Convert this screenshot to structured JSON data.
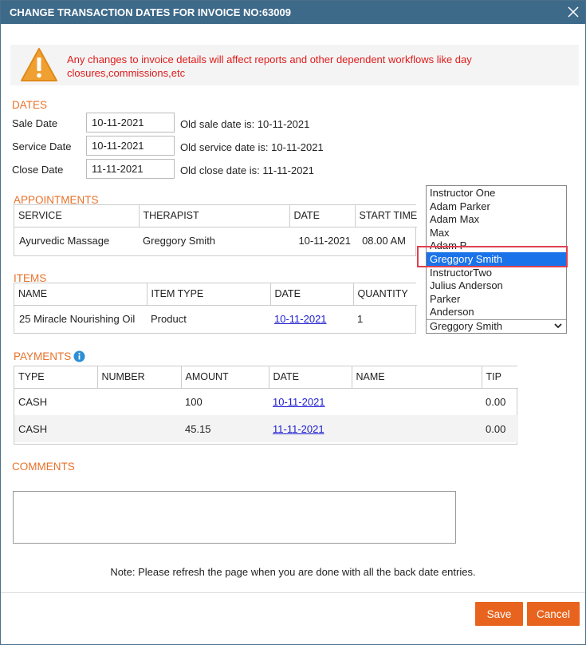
{
  "dialog": {
    "title": "CHANGE TRANSACTION DATES FOR INVOICE NO:63009",
    "warning": "Any changes to invoice details will affect reports and other dependent workflows like day closures,commissions,etc"
  },
  "dates": {
    "title": "DATES",
    "sale": {
      "label": "Sale Date",
      "value": "10-11-2021",
      "old": "Old sale date is: 10-11-2021"
    },
    "service": {
      "label": "Service Date",
      "value": "10-11-2021",
      "old": "Old service date is: 10-11-2021"
    },
    "close": {
      "label": "Close Date",
      "value": "11-11-2021",
      "old": "Old close date is: 11-11-2021"
    }
  },
  "appointments": {
    "title": "APPOINTMENTS",
    "headers": [
      "SERVICE",
      "THERAPIST",
      "DATE",
      "START TIME"
    ],
    "rows": [
      {
        "service": "Ayurvedic Massage",
        "therapist": "Greggory Smith",
        "date": "10-11-2021",
        "start": "08.00 AM"
      }
    ]
  },
  "therapist_dropdown": {
    "options": [
      "Instructor One",
      "Adam Parker",
      "Adam Max",
      "Max",
      "Adam P",
      "Greggory Smith",
      "InstructorTwo",
      "Julius Anderson",
      "Parker",
      "Anderson"
    ],
    "selected": "Greggory Smith"
  },
  "items": {
    "title": "ITEMS",
    "headers": [
      "NAME",
      "ITEM TYPE",
      "DATE",
      "QUANTITY"
    ],
    "rows": [
      {
        "name": "25 Miracle Nourishing Oil",
        "type": "Product",
        "date": "10-11-2021",
        "quantity": "1"
      }
    ]
  },
  "payments": {
    "title": "PAYMENTS",
    "headers": [
      "TYPE",
      "NUMBER",
      "AMOUNT",
      "DATE",
      "NAME",
      "TIP"
    ],
    "rows": [
      {
        "type": "CASH",
        "number": "",
        "amount": "100",
        "date": "10-11-2021",
        "name": "",
        "tip": "0.00"
      },
      {
        "type": "CASH",
        "number": "",
        "amount": "45.15",
        "date": "11-11-2021",
        "name": "",
        "tip": "0.00"
      }
    ]
  },
  "comments": {
    "title": "COMMENTS",
    "value": ""
  },
  "note": "Note: Please refresh the page when you are done with all the back date entries.",
  "buttons": {
    "save": "Save",
    "cancel": "Cancel"
  },
  "colors": {
    "titlebar": "#3e6a8a",
    "accent": "#e8641e",
    "section": "#e8722a",
    "warning_text": "#e01b1b",
    "selected": "#1a73e8"
  }
}
